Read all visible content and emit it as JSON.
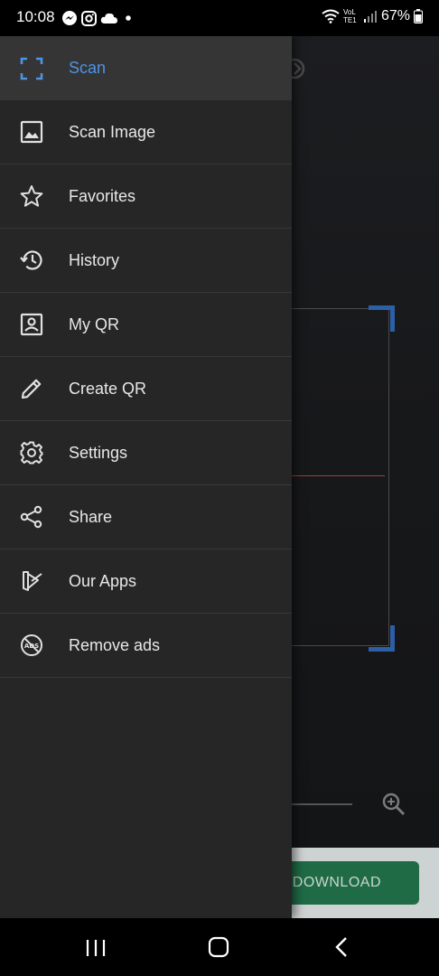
{
  "status_bar": {
    "time": "10:08",
    "battery": "67%",
    "network_label": "VoLTE1"
  },
  "drawer": {
    "accent_color": "#4e94e4",
    "items": [
      {
        "label": "Scan",
        "icon": "scan-frame-icon",
        "active": true
      },
      {
        "label": "Scan Image",
        "icon": "image-icon",
        "active": false
      },
      {
        "label": "Favorites",
        "icon": "star-icon",
        "active": false
      },
      {
        "label": "History",
        "icon": "history-icon",
        "active": false
      },
      {
        "label": "My QR",
        "icon": "contact-card-icon",
        "active": false
      },
      {
        "label": "Create QR",
        "icon": "pencil-icon",
        "active": false
      },
      {
        "label": "Settings",
        "icon": "gear-icon",
        "active": false
      },
      {
        "label": "Share",
        "icon": "share-icon",
        "active": false
      },
      {
        "label": "Our Apps",
        "icon": "apps-icon",
        "active": false
      },
      {
        "label": "Remove ads",
        "icon": "no-ads-icon",
        "active": false
      }
    ]
  },
  "ad": {
    "button_label": "DOWNLOAD"
  }
}
